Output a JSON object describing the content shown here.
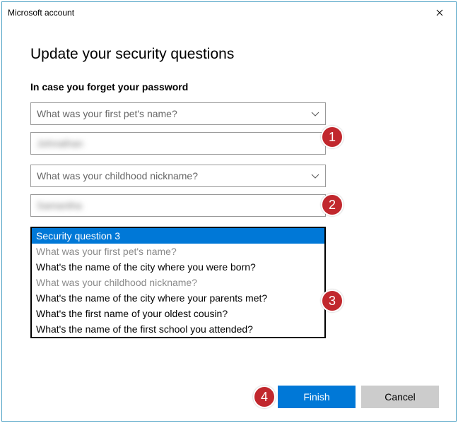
{
  "window": {
    "title": "Microsoft account"
  },
  "page": {
    "heading": "Update your security questions",
    "subheading": "In case you forget your password"
  },
  "q1": {
    "question": "What was your first pet's name?",
    "answer": "Johnathan"
  },
  "q2": {
    "question": "What was your childhood nickname?",
    "answer": "Samantha"
  },
  "dropdown": {
    "options": [
      {
        "label": "Security question 3",
        "selected": true,
        "disabled": false
      },
      {
        "label": "What was your first pet's name?",
        "selected": false,
        "disabled": true
      },
      {
        "label": "What's the name of the city where you were born?",
        "selected": false,
        "disabled": false
      },
      {
        "label": "What was your childhood nickname?",
        "selected": false,
        "disabled": true
      },
      {
        "label": "What's the name of the city where your parents met?",
        "selected": false,
        "disabled": false
      },
      {
        "label": "What's the first name of your oldest cousin?",
        "selected": false,
        "disabled": false
      },
      {
        "label": "What's the name of the first school you attended?",
        "selected": false,
        "disabled": false
      }
    ]
  },
  "buttons": {
    "finish": "Finish",
    "cancel": "Cancel"
  },
  "badges": {
    "b1": "1",
    "b2": "2",
    "b3": "3",
    "b4": "4"
  }
}
